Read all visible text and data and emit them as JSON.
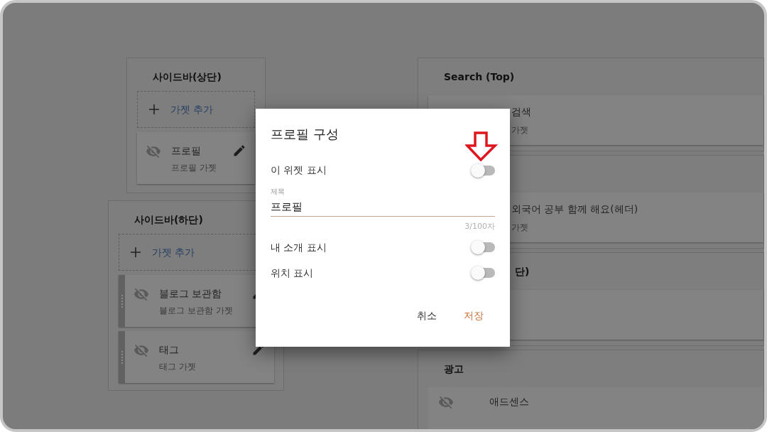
{
  "left_panels": [
    {
      "title": "사이드바(상단)",
      "add_label": "가젯 추가",
      "gadgets": [
        {
          "name": "프로필",
          "subtitle": "프로필 가젯",
          "handle": false
        }
      ]
    },
    {
      "title": "사이드바(하단)",
      "add_label": "가젯 추가",
      "gadgets": [
        {
          "name": "블로그 보관함",
          "subtitle": "블로그 보관함 가젯",
          "handle": true
        },
        {
          "name": "태그",
          "subtitle": "태그 가젯",
          "handle": true
        }
      ]
    }
  ],
  "right_panels": [
    {
      "title": "Search (Top)",
      "gadgets": [
        {
          "kind": "covered",
          "name": "검색",
          "subtitle": "가젯"
        }
      ]
    },
    {
      "gadgets": [
        {
          "kind": "covered",
          "name": "외국어 공부 함께 해요(헤더)",
          "subtitle": "가젯"
        }
      ]
    },
    {
      "title": "단)",
      "gadgets": [
        {
          "kind": "blank"
        }
      ]
    },
    {
      "title": "광고",
      "gadgets": [
        {
          "kind": "full",
          "name": "애드센스"
        }
      ]
    }
  ],
  "dialog": {
    "title": "프로필 구성",
    "toggles_top": [
      {
        "label": "이 위젯 표시",
        "on": false
      }
    ],
    "title_field": {
      "label": "제목",
      "value": "프로필",
      "counter": "3/100자"
    },
    "toggles": [
      {
        "label": "내 소개 표시",
        "on": false
      },
      {
        "label": "위치 표시",
        "on": false
      }
    ],
    "buttons": [
      {
        "label": "취소",
        "kind": "cancel"
      },
      {
        "label": "저장",
        "kind": "save"
      }
    ]
  }
}
